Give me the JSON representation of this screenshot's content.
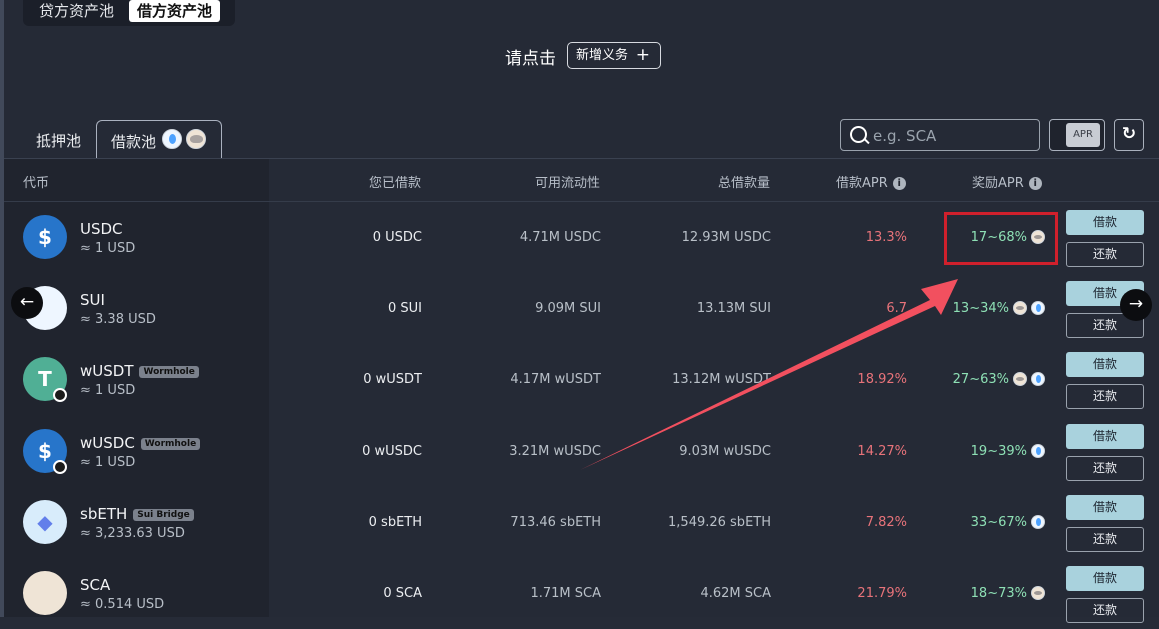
{
  "pool_tabs": [
    {
      "label": "贷方资产池",
      "active": false
    },
    {
      "label": "借方资产池",
      "active": true
    }
  ],
  "prompt_text": "请点击",
  "add_obligation_label": "新增义务",
  "sub_tabs": {
    "collateral": "抵押池",
    "borrow": "借款池"
  },
  "search": {
    "placeholder": "e.g. SCA",
    "value": ""
  },
  "apr_toggle_label": "APR",
  "columns": [
    "代币",
    "您已借款",
    "可用流动性",
    "总借款量",
    "借款APR",
    "奖励APR"
  ],
  "action_labels": {
    "borrow": "借款",
    "repay": "还款"
  },
  "colors": {
    "accent_button": "#a9d2dd",
    "apr_red": "#e8737a",
    "reward_green": "#8ee0b5",
    "highlight": "#d0202c",
    "annotation_arrow": "#f2505f"
  },
  "rows": [
    {
      "token": "USDC",
      "price": "≈ 1 USD",
      "tag": "",
      "borrowed": "0 USDC",
      "liquidity": "4.71M USDC",
      "total": "12.93M USDC",
      "borrow_apr": "13.3%",
      "reward_apr": "17~68%",
      "reward_icons": [
        "sca"
      ],
      "icon": "usdc-icon",
      "icon_color": "#2775ca"
    },
    {
      "token": "SUI",
      "price": "≈ 3.38 USD",
      "tag": "",
      "borrowed": "0 SUI",
      "liquidity": "9.09M SUI",
      "total": "13.13M SUI",
      "borrow_apr": "6.7",
      "reward_apr": "13~34%",
      "reward_icons": [
        "sca",
        "sui"
      ],
      "icon": "sui-icon",
      "icon_color": "#eef6ff"
    },
    {
      "token": "wUSDT",
      "price": "≈ 1 USD",
      "tag": "Wormhole",
      "borrowed": "0 wUSDT",
      "liquidity": "4.17M wUSDT",
      "total": "13.12M wUSDT",
      "borrow_apr": "18.92%",
      "reward_apr": "27~63%",
      "reward_icons": [
        "sca",
        "sui"
      ],
      "icon": "usdt-icon",
      "icon_color": "#50af95"
    },
    {
      "token": "wUSDC",
      "price": "≈ 1 USD",
      "tag": "Wormhole",
      "borrowed": "0 wUSDC",
      "liquidity": "3.21M wUSDC",
      "total": "9.03M wUSDC",
      "borrow_apr": "14.27%",
      "reward_apr": "19~39%",
      "reward_icons": [
        "sui"
      ],
      "icon": "usdc-icon",
      "icon_color": "#2775ca"
    },
    {
      "token": "sbETH",
      "price": "≈ 3,233.63 USD",
      "tag": "Sui Bridge",
      "borrowed": "0 sbETH",
      "liquidity": "713.46 sbETH",
      "total": "1,549.26 sbETH",
      "borrow_apr": "7.82%",
      "reward_apr": "33~67%",
      "reward_icons": [
        "sui"
      ],
      "icon": "eth-icon",
      "icon_color": "#d8ecfb"
    },
    {
      "token": "SCA",
      "price": "≈ 0.514 USD",
      "tag": "",
      "borrowed": "0 SCA",
      "liquidity": "1.71M SCA",
      "total": "4.62M SCA",
      "borrow_apr": "21.79%",
      "reward_apr": "18~73%",
      "reward_icons": [
        "sca"
      ],
      "icon": "sca-icon",
      "icon_color": "#efe4d6"
    }
  ]
}
